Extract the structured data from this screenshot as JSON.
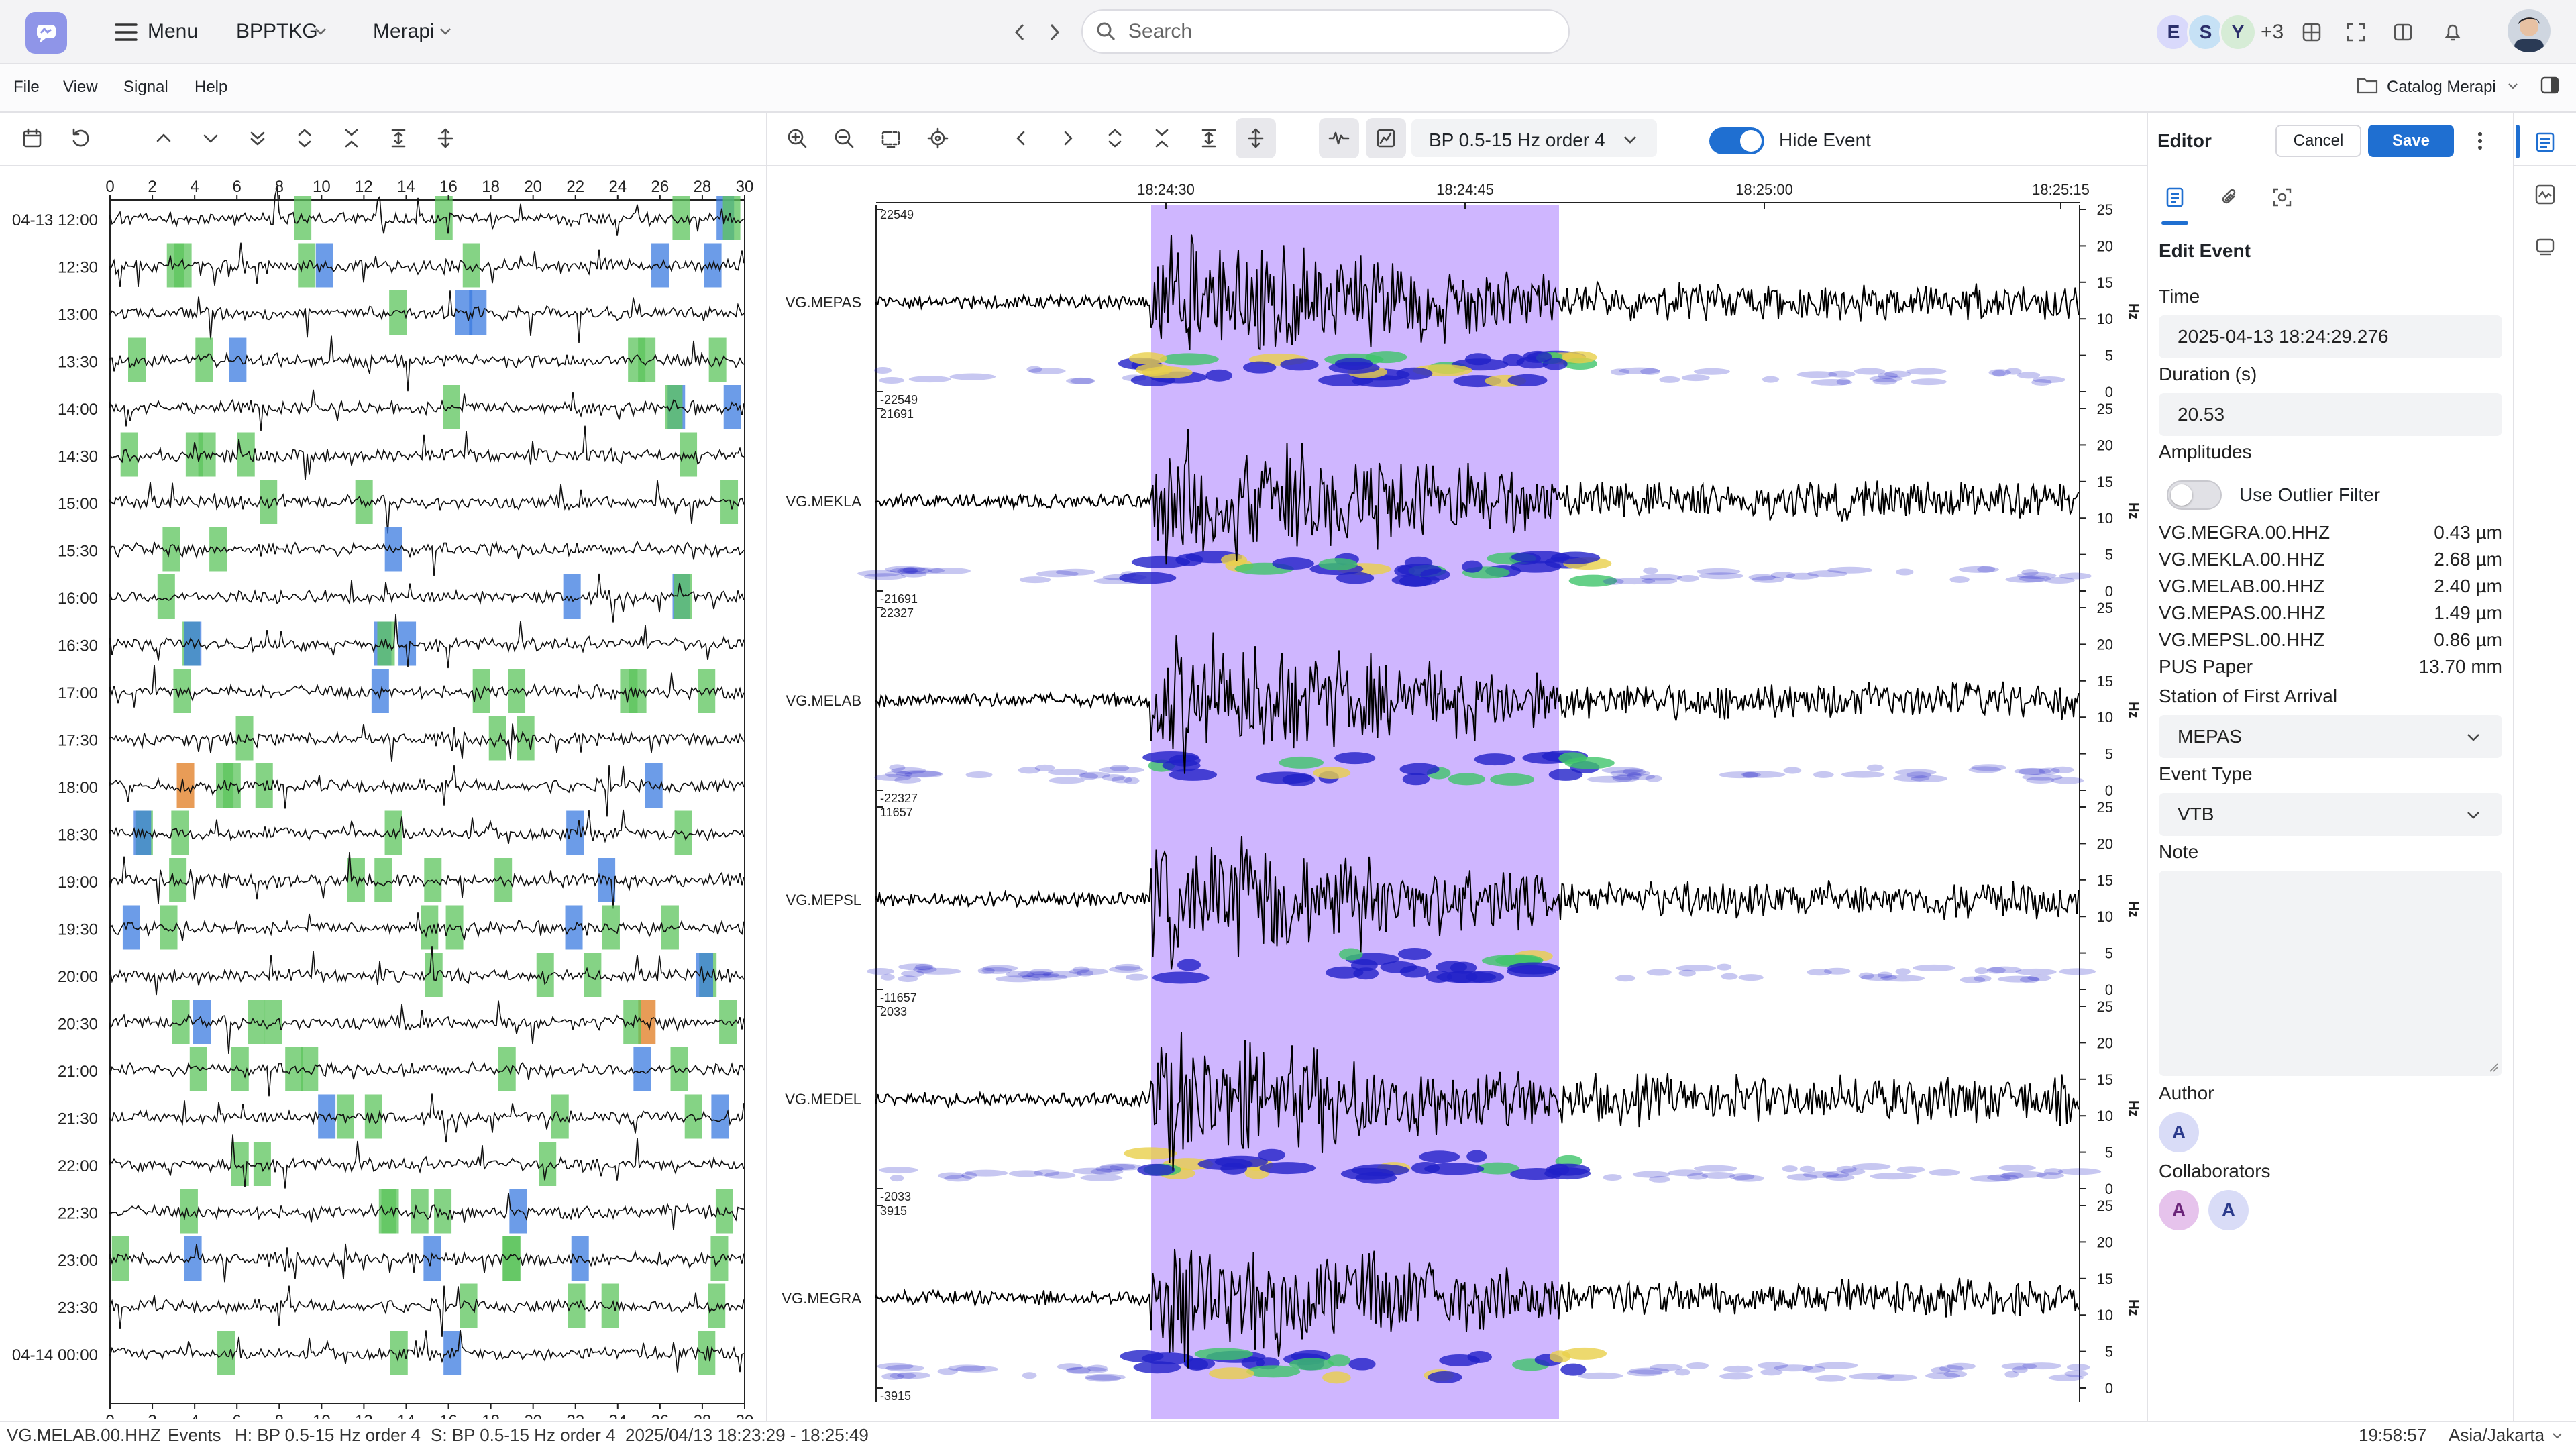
{
  "topbar": {
    "menu_label": "Menu",
    "org": "BPPTKG",
    "volcano": "Merapi",
    "search_placeholder": "Search",
    "more_users": "+3",
    "avatars": [
      "E",
      "S",
      "Y"
    ]
  },
  "menubar": {
    "items": [
      "File",
      "View",
      "Signal",
      "Help"
    ],
    "catalog": "Catalog Merapi"
  },
  "toolbar": {
    "filter": "BP 0.5-15 Hz order 4",
    "hide_event": "Hide Event",
    "hide_event_on": true
  },
  "helicorder": {
    "x_ticks": [
      "0",
      "2",
      "4",
      "6",
      "8",
      "10",
      "12",
      "14",
      "16",
      "18",
      "20",
      "22",
      "24",
      "26",
      "28",
      "30"
    ],
    "rows": [
      "04-13 12:00",
      "12:30",
      "13:00",
      "13:30",
      "14:00",
      "14:30",
      "15:00",
      "15:30",
      "16:00",
      "16:30",
      "17:00",
      "17:30",
      "18:00",
      "18:30",
      "19:00",
      "19:30",
      "20:00",
      "20:30",
      "21:00",
      "21:30",
      "22:00",
      "22:30",
      "23:00",
      "23:30",
      "04-14 00:00"
    ]
  },
  "seismogram": {
    "time_ticks": [
      "18:24:30",
      "18:24:45",
      "18:25:00",
      "18:25:15"
    ],
    "freq_ticks": [
      "25",
      "20",
      "15",
      "10",
      "5",
      "0"
    ],
    "freq_unit": "Hz",
    "channels": [
      {
        "name": "VG.MEPAS",
        "max": "22549",
        "min": "-22549"
      },
      {
        "name": "VG.MEKLA",
        "max": "21691",
        "min": "-21691"
      },
      {
        "name": "VG.MELAB",
        "max": "22327",
        "min": "-22327"
      },
      {
        "name": "VG.MEPSL",
        "max": "11657",
        "min": "-11657"
      },
      {
        "name": "VG.MEDEL",
        "max": "2033",
        "min": "-2033"
      },
      {
        "name": "VG.MEGRA",
        "max": "3915",
        "min": "-3915"
      }
    ]
  },
  "editor": {
    "title": "Editor",
    "cancel": "Cancel",
    "save": "Save",
    "heading": "Edit Event",
    "time_label": "Time",
    "time_value": "2025-04-13 18:24:29.276",
    "duration_label": "Duration (s)",
    "duration_value": "20.53",
    "amplitudes_label": "Amplitudes",
    "outlier_label": "Use Outlier Filter",
    "amplitudes": [
      {
        "station": "VG.MEGRA.00.HHZ",
        "value": "0.43 µm"
      },
      {
        "station": "VG.MEKLA.00.HHZ",
        "value": "2.68 µm"
      },
      {
        "station": "VG.MELAB.00.HHZ",
        "value": "2.40 µm"
      },
      {
        "station": "VG.MEPAS.00.HHZ",
        "value": "1.49 µm"
      },
      {
        "station": "VG.MEPSL.00.HHZ",
        "value": "0.86 µm"
      },
      {
        "station": "PUS Paper",
        "value": "13.70 mm"
      }
    ],
    "first_arrival_label": "Station of First Arrival",
    "first_arrival_value": "MEPAS",
    "event_type_label": "Event Type",
    "event_type_value": "VTB",
    "note_label": "Note",
    "author_label": "Author",
    "author": "A",
    "collaborators_label": "Collaborators",
    "collaborators": [
      "A",
      "A"
    ]
  },
  "statusbar": {
    "channel": "VG.MELAB.00.HHZ",
    "events": "Events",
    "helicorder_filter": "H: BP 0.5-15 Hz order 4",
    "seismogram_filter": "S: BP 0.5-15 Hz order 4",
    "range": "2025/04/13 18:23:29 - 18:25:49",
    "clock": "19:58:57",
    "timezone": "Asia/Jakarta"
  },
  "colors": {
    "accent": "#1f6fd1",
    "selection": "#c7a9ff",
    "event_green": "#5cc45c",
    "event_blue": "#3b7be0",
    "event_orange": "#e07b1f"
  }
}
